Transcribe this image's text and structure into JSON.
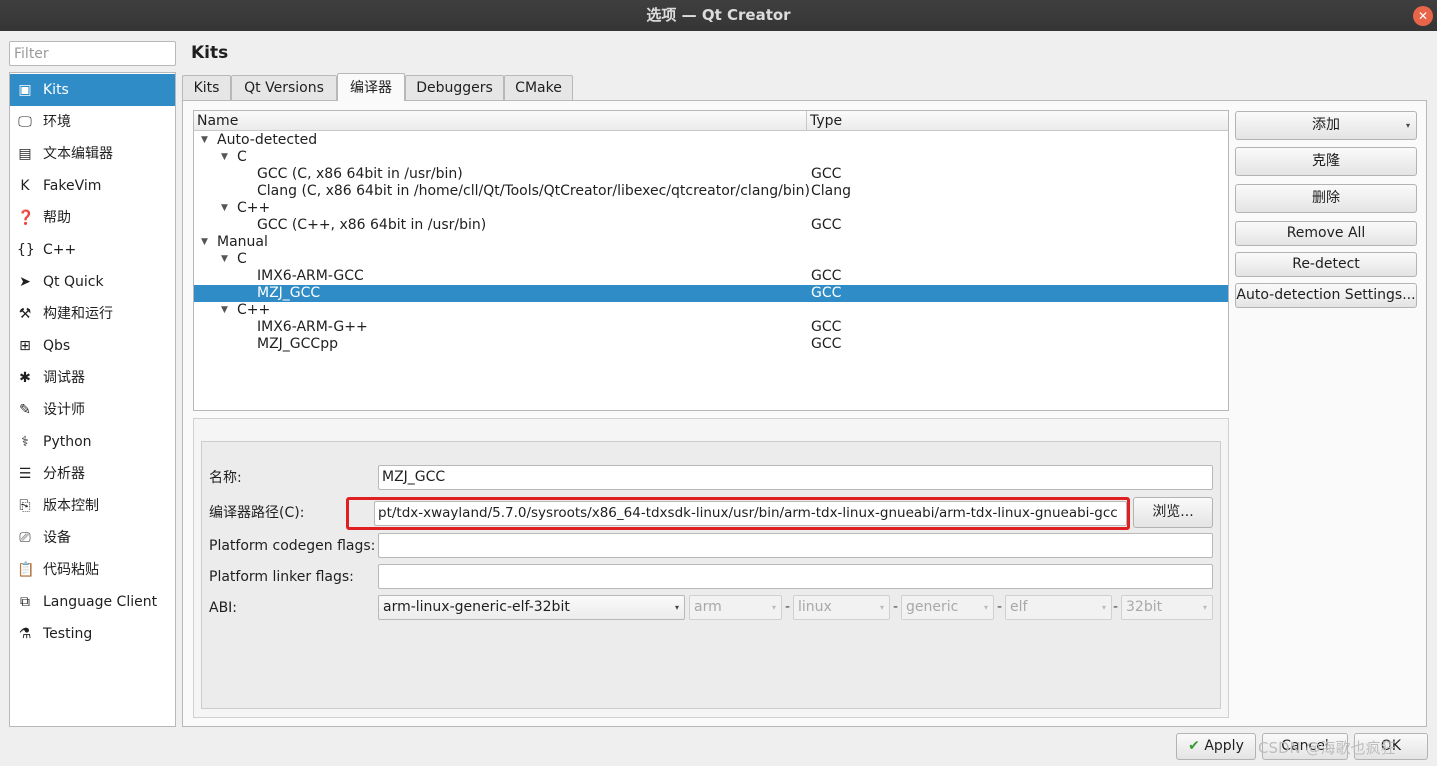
{
  "window": {
    "title": "选项 — Qt Creator",
    "close_glyph": "✕"
  },
  "filter": {
    "placeholder": "Filter"
  },
  "sidebar": {
    "items": [
      {
        "label": "Kits",
        "icon": "kits-icon",
        "glyph": "▣"
      },
      {
        "label": "环境",
        "icon": "monitor-icon",
        "glyph": "🖵"
      },
      {
        "label": "文本编辑器",
        "icon": "text-editor-icon",
        "glyph": "▤"
      },
      {
        "label": "FakeVim",
        "icon": "fakevim-icon",
        "glyph": "K"
      },
      {
        "label": "帮助",
        "icon": "help-icon",
        "glyph": "❓"
      },
      {
        "label": "C++",
        "icon": "braces-icon",
        "glyph": "{}"
      },
      {
        "label": "Qt Quick",
        "icon": "paper-plane-icon",
        "glyph": "➤"
      },
      {
        "label": "构建和运行",
        "icon": "hammer-icon",
        "glyph": "⚒"
      },
      {
        "label": "Qbs",
        "icon": "qbs-grid-icon",
        "glyph": "⊞"
      },
      {
        "label": "调试器",
        "icon": "bug-icon",
        "glyph": "✱"
      },
      {
        "label": "设计师",
        "icon": "pen-icon",
        "glyph": "✎"
      },
      {
        "label": "Python",
        "icon": "python-icon",
        "glyph": "⚕"
      },
      {
        "label": "分析器",
        "icon": "analyzer-icon",
        "glyph": "☰"
      },
      {
        "label": "版本控制",
        "icon": "version-control-icon",
        "glyph": "⎘"
      },
      {
        "label": "设备",
        "icon": "device-icon",
        "glyph": "⎚"
      },
      {
        "label": "代码粘贴",
        "icon": "paste-icon",
        "glyph": "📋"
      },
      {
        "label": "Language Client",
        "icon": "language-client-icon",
        "glyph": "⧉"
      },
      {
        "label": "Testing",
        "icon": "flask-icon",
        "glyph": "⚗"
      }
    ],
    "selected_index": 0
  },
  "page": {
    "title": "Kits"
  },
  "tabs": [
    {
      "label": "Kits"
    },
    {
      "label": "Qt Versions"
    },
    {
      "label": "编译器"
    },
    {
      "label": "Debuggers"
    },
    {
      "label": "CMake"
    }
  ],
  "active_tab": "编译器",
  "tree": {
    "headers": {
      "name": "Name",
      "type": "Type"
    },
    "rows": [
      {
        "name": "Auto-detected",
        "type": "",
        "level": 0,
        "expandable": true
      },
      {
        "name": "C",
        "type": "",
        "level": 1,
        "expandable": true
      },
      {
        "name": "GCC (C, x86 64bit in /usr/bin)",
        "type": "GCC",
        "level": 2,
        "expandable": false
      },
      {
        "name": "Clang (C, x86 64bit in /home/cll/Qt/Tools/QtCreator/libexec/qtcreator/clang/bin)",
        "type": "Clang",
        "level": 2,
        "expandable": false
      },
      {
        "name": "C++",
        "type": "",
        "level": 1,
        "expandable": true
      },
      {
        "name": "GCC (C++, x86 64bit in /usr/bin)",
        "type": "GCC",
        "level": 2,
        "expandable": false
      },
      {
        "name": "Manual",
        "type": "",
        "level": 0,
        "expandable": true
      },
      {
        "name": "C",
        "type": "",
        "level": 1,
        "expandable": true
      },
      {
        "name": "IMX6-ARM-GCC",
        "type": "GCC",
        "level": 2,
        "expandable": false
      },
      {
        "name": "MZJ_GCC",
        "type": "GCC",
        "level": 2,
        "expandable": false,
        "selected": true
      },
      {
        "name": "C++",
        "type": "",
        "level": 1,
        "expandable": true
      },
      {
        "name": "IMX6-ARM-G++",
        "type": "GCC",
        "level": 2,
        "expandable": false
      },
      {
        "name": "MZJ_GCCpp",
        "type": "GCC",
        "level": 2,
        "expandable": false
      }
    ]
  },
  "actions": {
    "add": "添加",
    "clone": "克隆",
    "remove": "删除",
    "remove_all": "Remove All",
    "redetect": "Re-detect",
    "auto_detection_settings": "Auto-detection Settings..."
  },
  "detail": {
    "name_label": "名称:",
    "name_value": "MZJ_GCC",
    "path_label": "编译器路径(C):",
    "path_value": "pt/tdx-xwayland/5.7.0/sysroots/x86_64-tdxsdk-linux/usr/bin/arm-tdx-linux-gnueabi/arm-tdx-linux-gnueabi-gcc",
    "browse": "浏览...",
    "codegen_label": "Platform codegen flags:",
    "codegen_value": "",
    "linker_label": "Platform linker flags:",
    "linker_value": "",
    "abi_label": "ABI:",
    "abi": {
      "main": "arm-linux-generic-elf-32bit",
      "arch": "arm",
      "os": "linux",
      "flavor": "generic",
      "format": "elf",
      "width": "32bit",
      "separator": "-"
    }
  },
  "bottom": {
    "apply": "Apply",
    "cancel": "Cancel",
    "ok": "OK",
    "apply_glyph": "✔"
  },
  "watermark": "CSDN @海歌也疯狂",
  "colors": {
    "selection": "#308cc6",
    "highlight_box": "#e02020",
    "titlebar": "#3a3a3a",
    "close": "#e8654a"
  }
}
